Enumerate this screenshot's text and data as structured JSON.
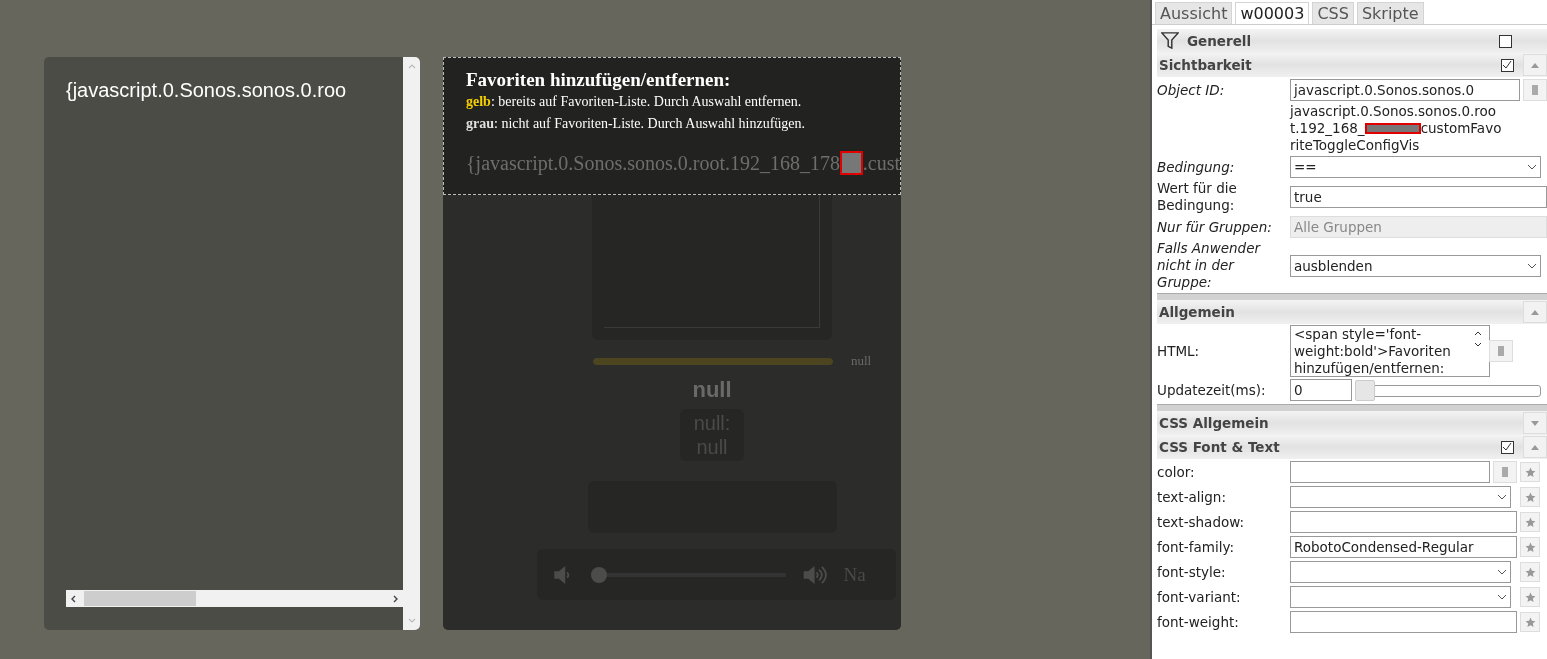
{
  "canvas": {
    "text_widget": {
      "text": "{javascript.0.Sonos.sonos.0.roo"
    },
    "player": {
      "progress": {
        "level": 1,
        "reading": "null"
      },
      "title": "null",
      "subtitle": "null: null",
      "volume": {
        "level": 0
      },
      "source": "Na"
    },
    "overlay": {
      "title": "Favoriten hinzufügen/entfernen:",
      "legend": [
        {
          "term": "gelb",
          "text": ": bereits auf Favoriten-Liste. Durch Auswahl entfernen.",
          "color": "#f5d000"
        },
        {
          "term": "grau",
          "text": ": nicht auf Favoriten-Liste. Durch Auswahl hinzufügen.",
          "color": "#e0e0e0"
        }
      ],
      "id_start": "{javascript.0.Sonos.sonos.0.root.192_168_178",
      "id_end": ".cust"
    }
  },
  "inspector": {
    "tabs": [
      {
        "label": "Aussicht",
        "selected": false
      },
      {
        "label": "w00003",
        "selected": true
      },
      {
        "label": "CSS",
        "selected": false
      },
      {
        "label": "Skripte",
        "selected": false
      }
    ],
    "filter_header": {
      "title": "Generell",
      "checked": false
    },
    "groups": [
      {
        "title": "Sichtbarkeit",
        "checked": true,
        "expanded": true,
        "rows": [
          {
            "kind": "input",
            "label": "Object ID:",
            "italic": true,
            "value": "javascript.0.Sonos.sonos.0",
            "picker": true,
            "star": false
          },
          {
            "kind": "id-note",
            "line_1": "javascript.0.Sonos.sonos.0.roo",
            "line_2_start": "t.192_168_",
            "line_2_end": "customFavo",
            "line_3": "riteToggleConfigVis"
          },
          {
            "kind": "select",
            "label": "Bedingung:",
            "italic": true,
            "value": "==",
            "disabled": false,
            "star": false
          },
          {
            "kind": "input",
            "label": "Wert für die Bedingung:",
            "italic": false,
            "value": "true",
            "picker": false,
            "star": false
          },
          {
            "kind": "select",
            "label": "Nur für Gruppen:",
            "italic": true,
            "value": "Alle Gruppen",
            "disabled": true,
            "star": false
          },
          {
            "kind": "select",
            "label": "Falls Anwender nicht in der Gruppe:",
            "italic": true,
            "value": "ausblenden",
            "disabled": false,
            "star": false
          }
        ]
      },
      {
        "title": "Allgemein",
        "expanded": true,
        "rows": [
          {
            "kind": "textarea",
            "label": "HTML:",
            "italic": false,
            "value": "<span style='font-weight:bold'>Favoriten hinzufügen/entfernen:",
            "picker": true
          },
          {
            "kind": "number-slider",
            "label": "Updatezeit(ms):",
            "italic": false,
            "value": "0",
            "level": 0
          }
        ]
      },
      {
        "title": "CSS Allgemein",
        "expanded": false
      },
      {
        "title": "CSS Font & Text",
        "checked": true,
        "expanded": true,
        "rows": [
          {
            "kind": "input",
            "label": "color:",
            "italic": false,
            "value": "",
            "picker": true,
            "star": true
          },
          {
            "kind": "select",
            "label": "text-align:",
            "italic": false,
            "value": "",
            "disabled": false,
            "star": true
          },
          {
            "kind": "input",
            "label": "text-shadow:",
            "italic": false,
            "value": "",
            "picker": false,
            "star": true
          },
          {
            "kind": "input",
            "label": "font-family:",
            "italic": false,
            "value": "RobotoCondensed-Regular",
            "picker": false,
            "star": true
          },
          {
            "kind": "select",
            "label": "font-style:",
            "italic": false,
            "value": "",
            "disabled": false,
            "star": true
          },
          {
            "kind": "select",
            "label": "font-variant:",
            "italic": false,
            "value": "",
            "disabled": false,
            "star": true
          },
          {
            "kind": "input",
            "label": "font-weight:",
            "italic": false,
            "value": "",
            "picker": false,
            "star": true
          }
        ]
      }
    ]
  }
}
